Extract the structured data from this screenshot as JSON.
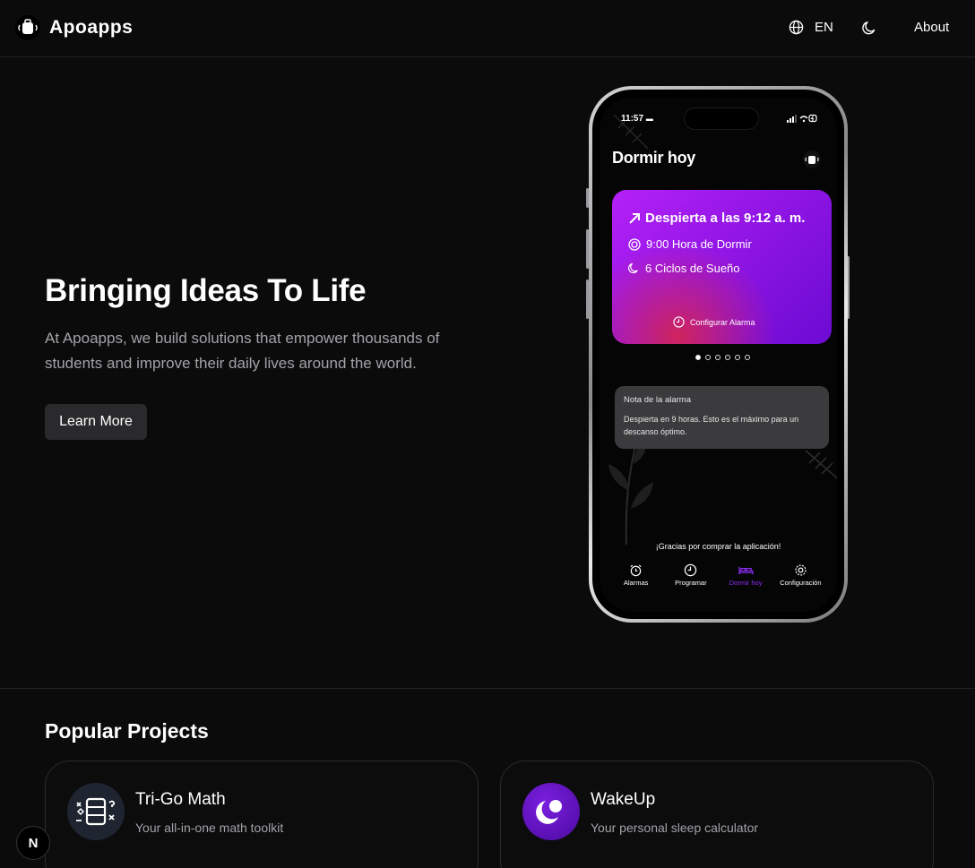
{
  "header": {
    "brand": "Apoapps",
    "language": "EN",
    "about": "About"
  },
  "hero": {
    "title": "Bringing Ideas To Life",
    "description": "At Apoapps, we build solutions that empower thousands of students and improve their daily lives around the world.",
    "cta": "Learn More"
  },
  "phone": {
    "time": "11:57",
    "app_title": "Dormir hoy",
    "card": {
      "wake": "Despierta a las 9:12 a. m.",
      "bedtime": "9:00 Hora de Dormir",
      "cycles": "6 Ciclos de Sueño",
      "configure": "Configurar Alarma"
    },
    "pager": {
      "count": 6,
      "active": 0
    },
    "note": {
      "title": "Nota de la alarma",
      "body": "Despierta en 9 horas. Esto es el máximo para un descanso óptimo."
    },
    "thanks": "¡Gracias por comprar la aplicación!",
    "tabs": [
      {
        "label": "Alarmas",
        "icon": "alarm-clock-icon",
        "active": false
      },
      {
        "label": "Programar",
        "icon": "clock-icon",
        "active": false
      },
      {
        "label": "Dormir hoy",
        "icon": "bed-icon",
        "active": true
      },
      {
        "label": "Configuración",
        "icon": "gear-icon",
        "active": false
      }
    ],
    "accent": "#8b2cf5"
  },
  "projects": {
    "title": "Popular Projects",
    "items": [
      {
        "name": "Tri-Go Math",
        "description": "Your all-in-one math toolkit",
        "icon": "math-toolkit-icon"
      },
      {
        "name": "WakeUp",
        "description": "Your personal sleep calculator",
        "icon": "moon-icon"
      }
    ]
  },
  "badge": {
    "label": "N"
  }
}
